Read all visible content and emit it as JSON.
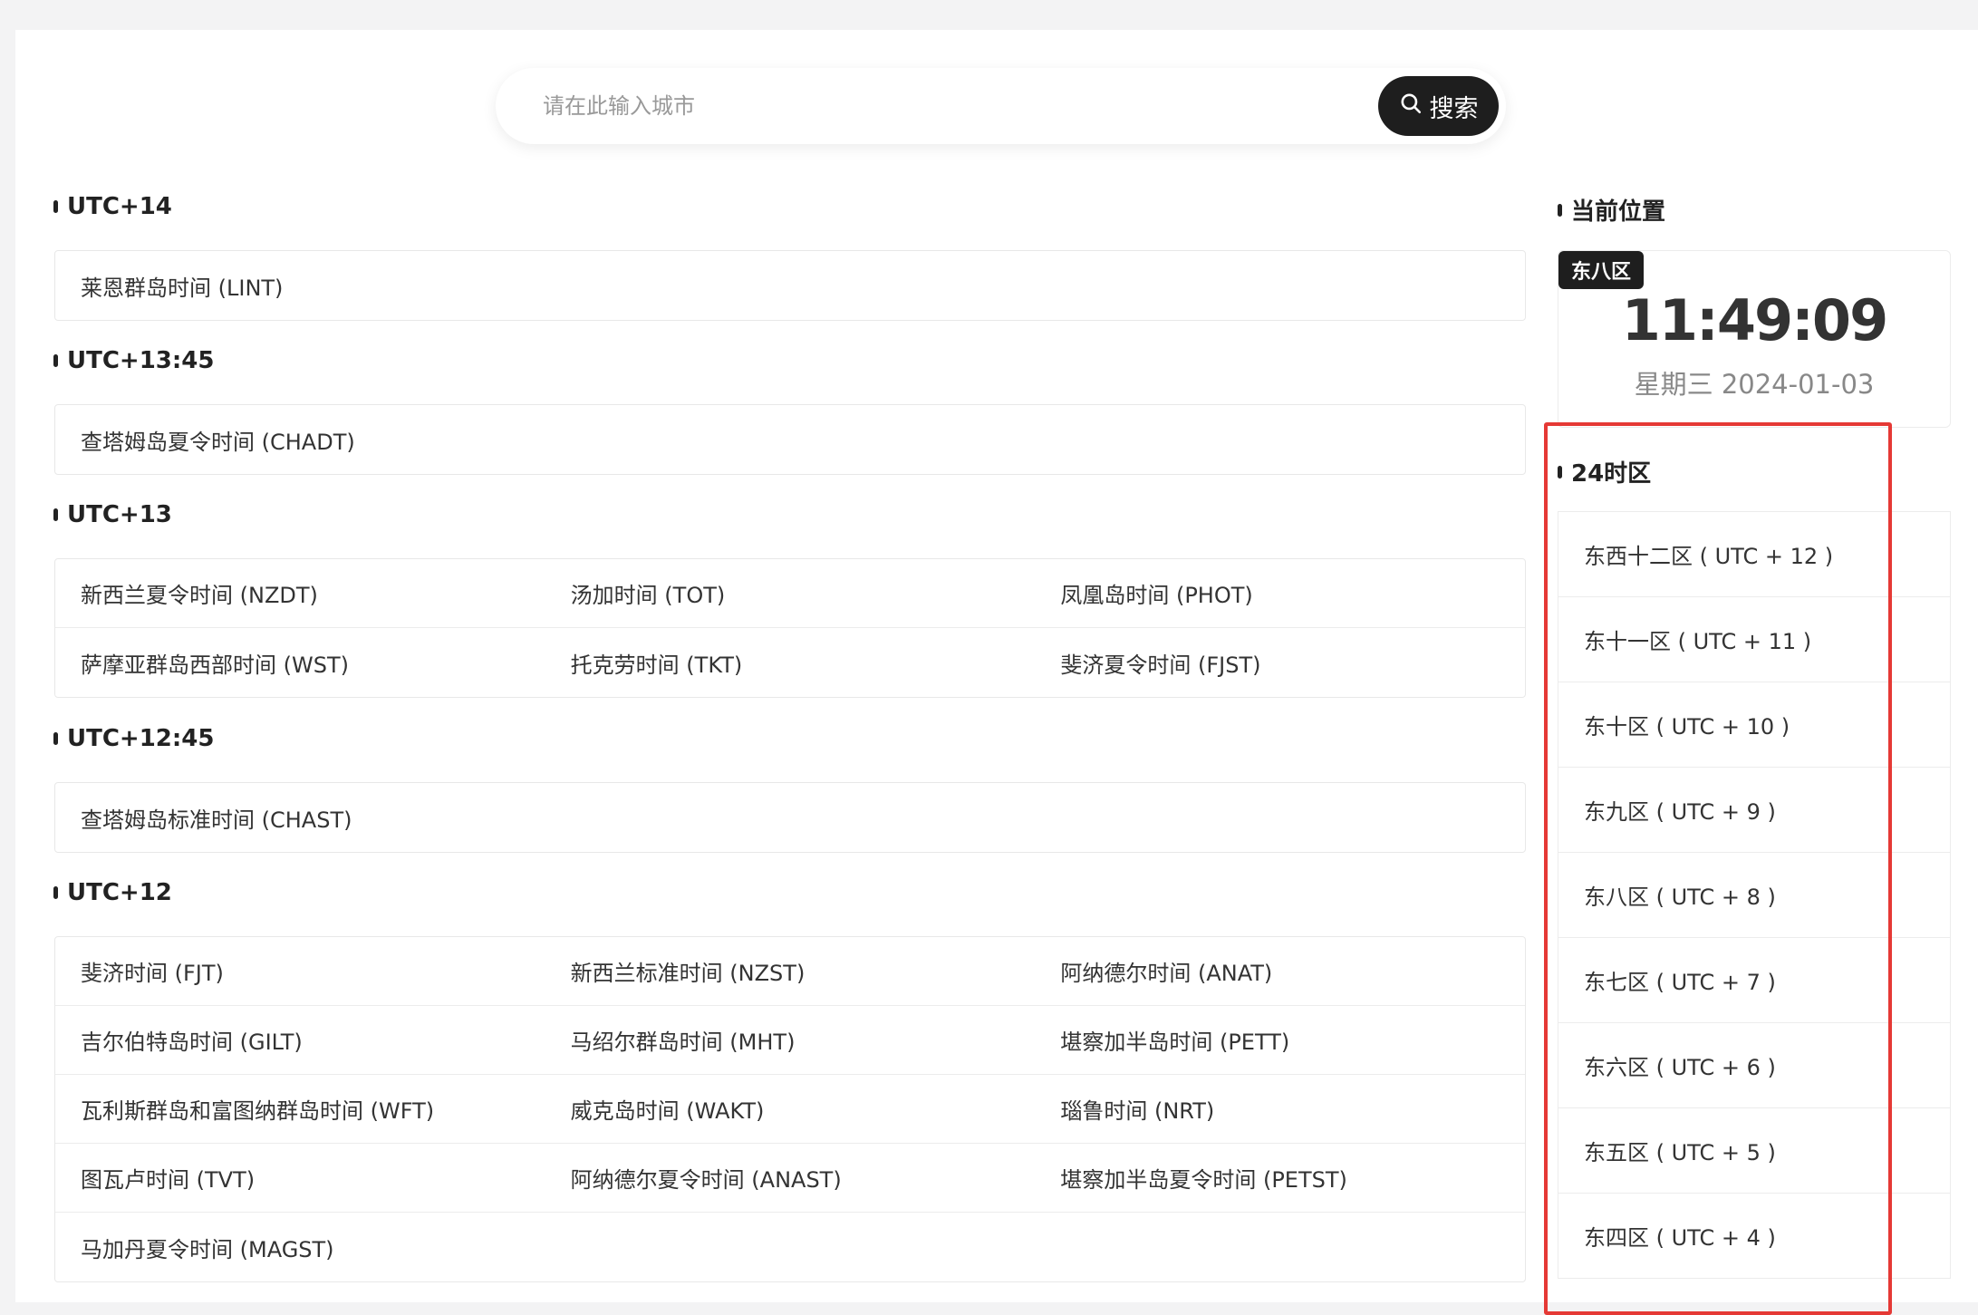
{
  "search": {
    "placeholder": "请在此输入城市",
    "button_label": "搜索"
  },
  "sections": [
    {
      "title": "UTC+14",
      "rows": [
        [
          "莱恩群岛时间 (LINT)"
        ]
      ]
    },
    {
      "title": "UTC+13:45",
      "rows": [
        [
          "查塔姆岛夏令时间 (CHADT)"
        ]
      ]
    },
    {
      "title": "UTC+13",
      "rows": [
        [
          "新西兰夏令时间 (NZDT)",
          "汤加时间 (TOT)",
          "凤凰岛时间 (PHOT)"
        ],
        [
          "萨摩亚群岛西部时间 (WST)",
          "托克劳时间 (TKT)",
          "斐济夏令时间 (FJST)"
        ]
      ]
    },
    {
      "title": "UTC+12:45",
      "rows": [
        [
          "查塔姆岛标准时间 (CHAST)"
        ]
      ]
    },
    {
      "title": "UTC+12",
      "rows": [
        [
          "斐济时间 (FJT)",
          "新西兰标准时间 (NZST)",
          "阿纳德尔时间 (ANAT)"
        ],
        [
          "吉尔伯特岛时间 (GILT)",
          "马绍尔群岛时间 (MHT)",
          "堪察加半岛时间 (PETT)"
        ],
        [
          "瓦利斯群岛和富图纳群岛时间 (WFT)",
          "威克岛时间 (WAKT)",
          "瑙鲁时间 (NRT)"
        ],
        [
          "图瓦卢时间 (TVT)",
          "阿纳德尔夏令时间 (ANAST)",
          "堪察加半岛夏令时间 (PETST)"
        ],
        [
          "马加丹夏令时间 (MAGST)"
        ]
      ]
    }
  ],
  "sidebar": {
    "current_title": "当前位置",
    "zone_badge": "东八区",
    "time": "11:49:09",
    "date": "星期三  2024-01-03",
    "tz_title": "24时区",
    "tz_items": [
      "东西十二区 ( UTC + 12 )",
      "东十一区 ( UTC + 11 )",
      "东十区 ( UTC + 10 )",
      "东九区 ( UTC + 9 )",
      "东八区 ( UTC + 8 )",
      "东七区 ( UTC + 7 )",
      "东六区 ( UTC + 6 )",
      "东五区 ( UTC + 5 )",
      "东四区 ( UTC + 4 )"
    ]
  },
  "colors": {
    "highlight": "#e53935",
    "button_bg": "#1e1e1e"
  }
}
